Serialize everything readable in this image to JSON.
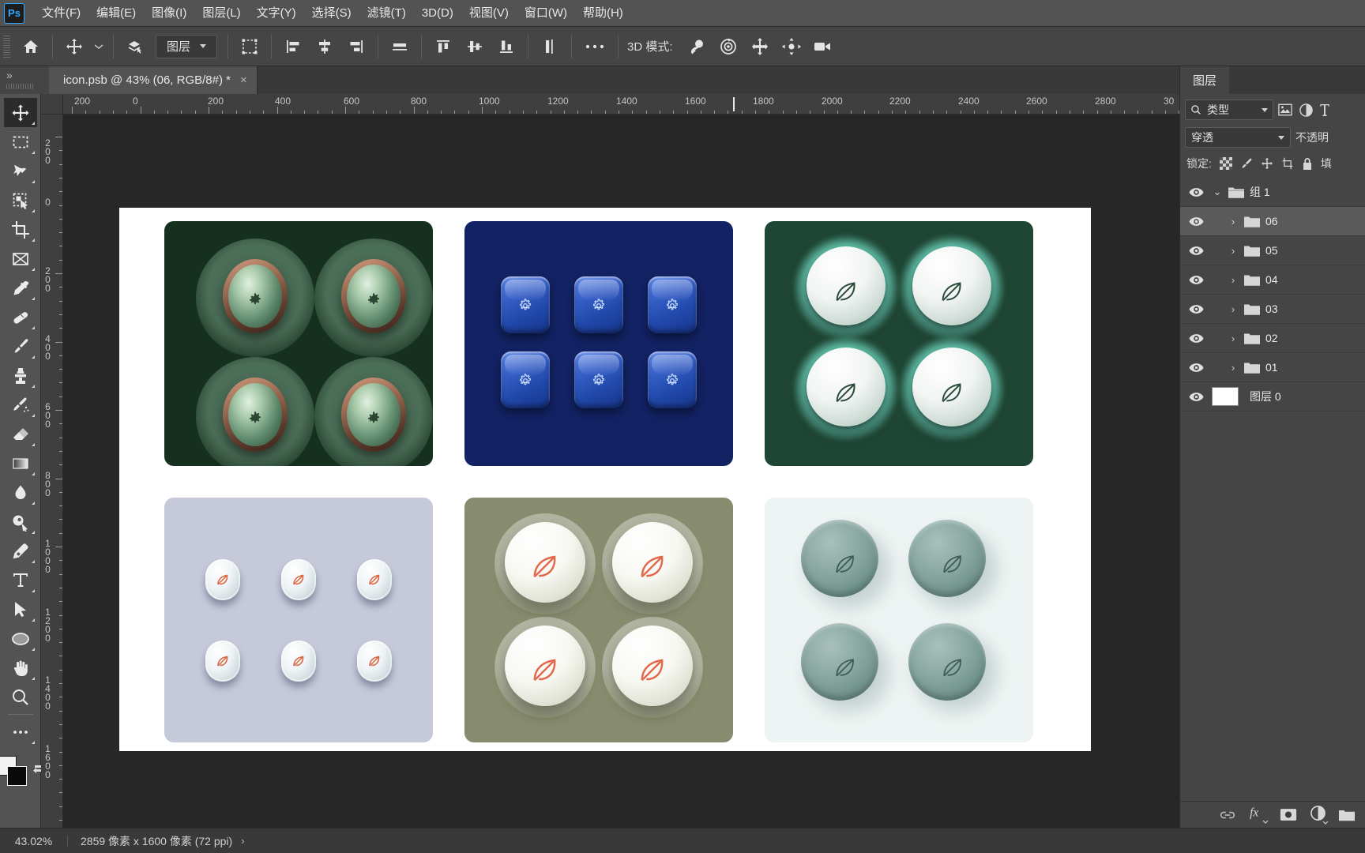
{
  "app": {
    "logo_text": "Ps"
  },
  "menubar": {
    "items": [
      {
        "label": "文件(F)",
        "name": "menu-file"
      },
      {
        "label": "编辑(E)",
        "name": "menu-edit"
      },
      {
        "label": "图像(I)",
        "name": "menu-image"
      },
      {
        "label": "图层(L)",
        "name": "menu-layer"
      },
      {
        "label": "文字(Y)",
        "name": "menu-type"
      },
      {
        "label": "选择(S)",
        "name": "menu-select"
      },
      {
        "label": "滤镜(T)",
        "name": "menu-filter"
      },
      {
        "label": "3D(D)",
        "name": "menu-3d"
      },
      {
        "label": "视图(V)",
        "name": "menu-view"
      },
      {
        "label": "窗口(W)",
        "name": "menu-window"
      },
      {
        "label": "帮助(H)",
        "name": "menu-help"
      }
    ]
  },
  "optionsbar": {
    "home_icon": "home-icon",
    "move_tool_icon": "move-tool-icon",
    "auto_select_icon": "layers-auto-select-icon",
    "auto_select_value": "图层",
    "transform_controls_icon": "transform-controls-icon",
    "align_left_icon": "align-left-edges-icon",
    "align_hcenter_icon": "align-horizontal-centers-icon",
    "align_right_icon": "align-right-edges-icon",
    "distribute_h_icon": "distribute-horizontal-icon",
    "align_top_icon": "align-top-edges-icon",
    "align_vcenter_icon": "align-vertical-centers-icon",
    "align_bottom_icon": "align-bottom-edges-icon",
    "distribute_v_icon": "distribute-vertical-icon",
    "more_icon": "more-options-icon",
    "mode_3d_label": "3D 模式:",
    "mode_3d_icons": [
      "3d-orbit-icon",
      "3d-roll-icon",
      "3d-pan-icon",
      "3d-slide-icon",
      "3d-camera-icon"
    ]
  },
  "tabbar": {
    "collapse_label": "»",
    "document": {
      "title": "icon.psb @ 43% (06, RGB/8#) *",
      "close_label": "×"
    }
  },
  "toolbar": {
    "tools": [
      {
        "name": "move-tool",
        "icon": "move-tool-icon",
        "active": true
      },
      {
        "name": "rectangular-marquee-tool",
        "icon": "rectangular-marquee-icon",
        "active": false
      },
      {
        "name": "lasso-tool",
        "icon": "lasso-icon",
        "active": false
      },
      {
        "name": "object-selection-tool",
        "icon": "object-selection-icon",
        "active": false
      },
      {
        "name": "crop-tool",
        "icon": "crop-icon",
        "active": false
      },
      {
        "name": "frame-tool",
        "icon": "frame-icon",
        "active": false
      },
      {
        "name": "eyedropper-tool",
        "icon": "eyedropper-icon",
        "active": false
      },
      {
        "name": "healing-brush-tool",
        "icon": "healing-brush-icon",
        "active": false
      },
      {
        "name": "brush-tool",
        "icon": "brush-icon",
        "active": false
      },
      {
        "name": "clone-stamp-tool",
        "icon": "clone-stamp-icon",
        "active": false
      },
      {
        "name": "history-brush-tool",
        "icon": "history-brush-icon",
        "active": false
      },
      {
        "name": "eraser-tool",
        "icon": "eraser-icon",
        "active": false
      },
      {
        "name": "gradient-tool",
        "icon": "gradient-icon",
        "active": false
      },
      {
        "name": "blur-tool",
        "icon": "blur-droplet-icon",
        "active": false
      },
      {
        "name": "dodge-tool",
        "icon": "dodge-icon",
        "active": false
      },
      {
        "name": "pen-tool",
        "icon": "pen-icon",
        "active": false
      },
      {
        "name": "type-tool",
        "icon": "type-T-icon",
        "active": false
      },
      {
        "name": "path-selection-tool",
        "icon": "path-selection-arrow-icon",
        "active": false
      },
      {
        "name": "ellipse-tool",
        "icon": "ellipse-icon",
        "active": false
      },
      {
        "name": "hand-tool",
        "icon": "hand-icon",
        "active": false
      },
      {
        "name": "zoom-tool",
        "icon": "zoom-magnifier-icon",
        "active": false
      },
      {
        "name": "edit-toolbar",
        "icon": "ellipsis-icon",
        "active": false
      }
    ],
    "foreground_color": "#f2f2f2",
    "background_color": "#0a0a0a",
    "swap_icon": "swap-colors-icon"
  },
  "rulers": {
    "unit": "px",
    "horizontal_labels": [
      "200",
      "0",
      "200",
      "400",
      "600",
      "800",
      "1000",
      "1200",
      "1400",
      "1600",
      "1800",
      "2000",
      "2200",
      "2400",
      "2600",
      "2800",
      "30"
    ],
    "vertical_labels": [
      "200",
      "0",
      "200",
      "400",
      "600",
      "800",
      "1000",
      "1200",
      "1400",
      "1600"
    ]
  },
  "canvas": {
    "artboard_bg": "#ffffff",
    "cells": [
      {
        "name": "icon-set-dark-green-metal",
        "bg": "#16301f",
        "style": "metal-knob",
        "count": 4,
        "glyph": "gear-icon"
      },
      {
        "name": "icon-set-blue-glass",
        "bg": "#122263",
        "style": "glass-square",
        "count": 6,
        "glyph": "gear-icon"
      },
      {
        "name": "icon-set-green-glow",
        "bg": "#1f4534",
        "style": "glow-circle",
        "count": 4,
        "glyph": "leaf-icon"
      },
      {
        "name": "icon-set-lavender-capsule",
        "bg": "#c6c9da",
        "style": "capsule",
        "count": 6,
        "glyph": "leaf-icon"
      },
      {
        "name": "icon-set-olive-white",
        "bg": "#878c6e",
        "style": "olive-circle",
        "count": 4,
        "glyph": "leaf-icon"
      },
      {
        "name": "icon-set-pale-sage",
        "bg": "#eef4f3",
        "style": "sage-circle",
        "count": 4,
        "glyph": "leaf-icon"
      }
    ]
  },
  "panel": {
    "tab_label": "图层",
    "filter": {
      "icon": "search-icon",
      "value": "类型",
      "chevron": "chevron-down-icon",
      "type_icons": [
        "pixel-layer-filter-icon",
        "adjustment-layer-filter-icon",
        "type-layer-filter-icon"
      ]
    },
    "blend_mode": {
      "value": "穿透",
      "chevron": "chevron-down-icon"
    },
    "opacity_label": "不透明",
    "lock": {
      "label": "锁定:",
      "icons": [
        "lock-transparent-pixels-icon",
        "lock-image-pixels-icon",
        "lock-position-icon",
        "lock-artboard-nesting-icon",
        "lock-all-icon"
      ],
      "fill_label": "填"
    },
    "layers": [
      {
        "name": "组 1",
        "type": "group",
        "expanded": true,
        "visible": true,
        "selected": false,
        "indent": 0
      },
      {
        "name": "06",
        "type": "group",
        "expanded": false,
        "visible": true,
        "selected": true,
        "indent": 1
      },
      {
        "name": "05",
        "type": "group",
        "expanded": false,
        "visible": true,
        "selected": false,
        "indent": 1
      },
      {
        "name": "04",
        "type": "group",
        "expanded": false,
        "visible": true,
        "selected": false,
        "indent": 1
      },
      {
        "name": "03",
        "type": "group",
        "expanded": false,
        "visible": true,
        "selected": false,
        "indent": 1
      },
      {
        "name": "02",
        "type": "group",
        "expanded": false,
        "visible": true,
        "selected": false,
        "indent": 1
      },
      {
        "name": "01",
        "type": "group",
        "expanded": false,
        "visible": true,
        "selected": false,
        "indent": 1
      },
      {
        "name": "图层 0",
        "type": "layer",
        "expanded": false,
        "visible": true,
        "selected": false,
        "indent": 0
      }
    ],
    "footer_icons": [
      "link-layers-icon",
      "layer-style-fx-icon",
      "add-layer-mask-icon",
      "new-adjustment-layer-icon",
      "new-group-icon"
    ]
  },
  "statusbar": {
    "zoom": "43.02%",
    "dimensions": "2859 像素 x 1600 像素 (72 ppi)",
    "expander": "›"
  }
}
